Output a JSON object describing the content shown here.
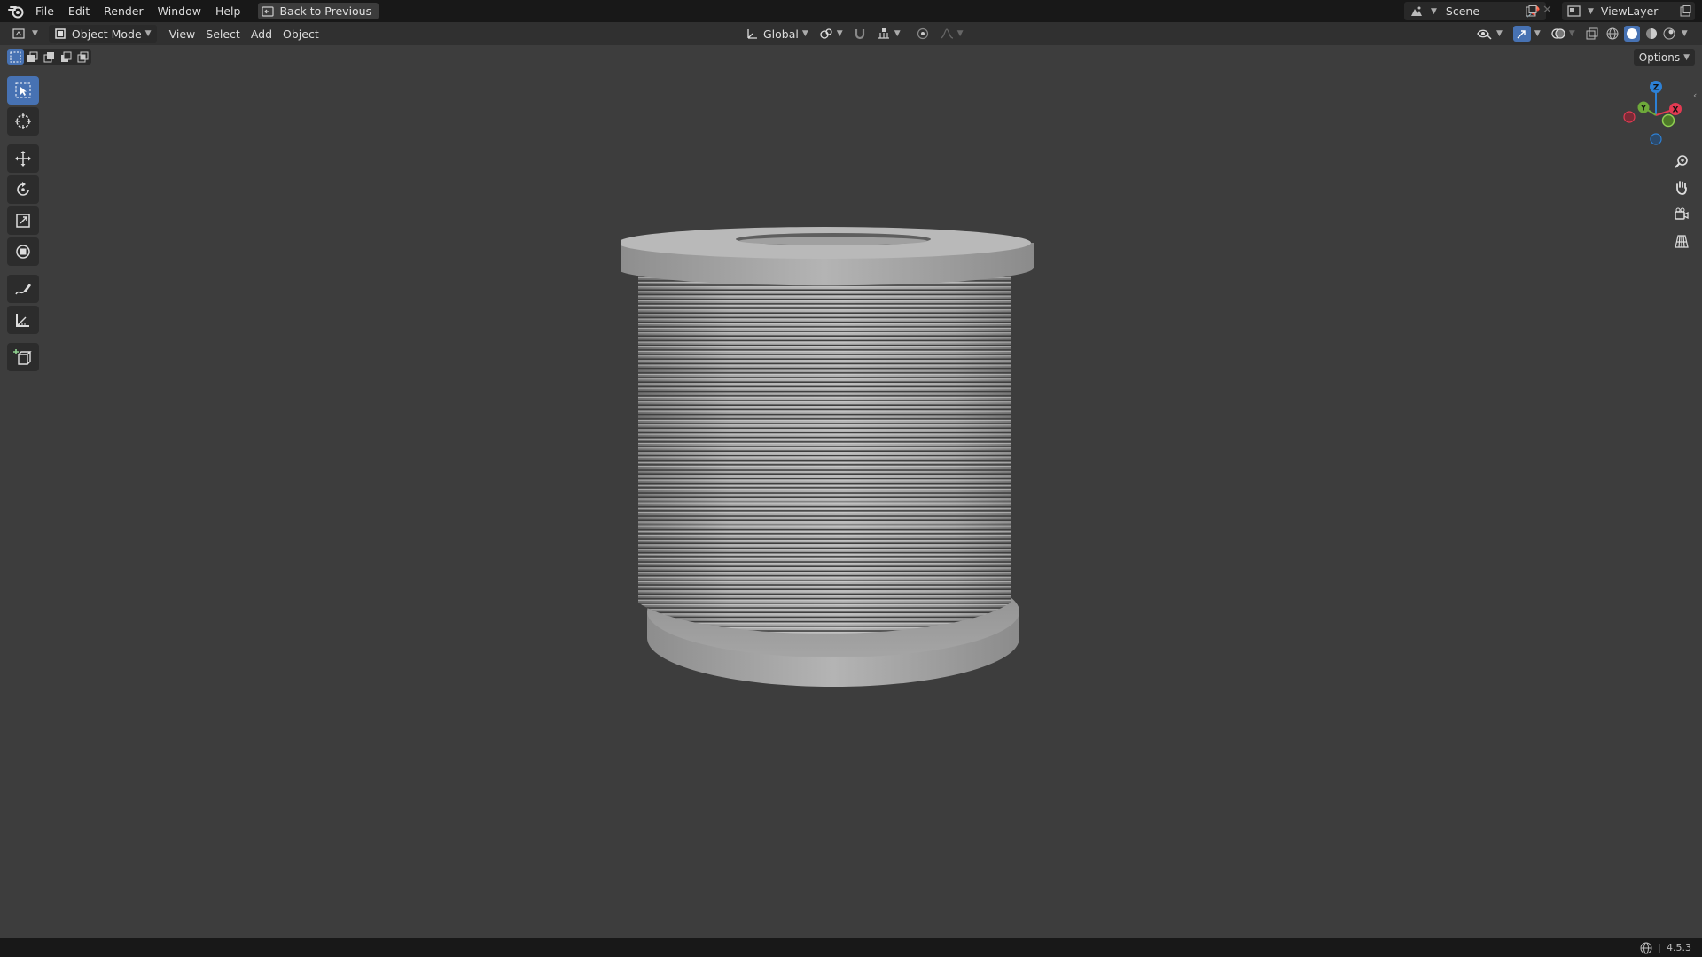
{
  "menubar": {
    "items": [
      "File",
      "Edit",
      "Render",
      "Window",
      "Help"
    ],
    "back_button": "Back to Previous",
    "scene_name": "Scene",
    "view_layer_name": "ViewLayer"
  },
  "viewport_header": {
    "mode": "Object Mode",
    "menus": [
      "View",
      "Select",
      "Add",
      "Object"
    ],
    "transform_orientation": "Global"
  },
  "options_label": "Options",
  "version": "4.5.3",
  "gizmo": {
    "z": "Z",
    "y": "Y",
    "x": "X"
  },
  "colors": {
    "accent": "#4772b3",
    "axis_x": "#e23a52",
    "axis_y": "#6ea93a",
    "axis_z": "#2d81d6",
    "viewport_bg": "#3d3d3d",
    "object": "#a9a9a9"
  },
  "tools": [
    "select-box-icon",
    "cursor-icon",
    "move-icon",
    "rotate-icon",
    "scale-icon",
    "transform-icon",
    "annotate-icon",
    "measure-icon",
    "add-cube-icon"
  ]
}
